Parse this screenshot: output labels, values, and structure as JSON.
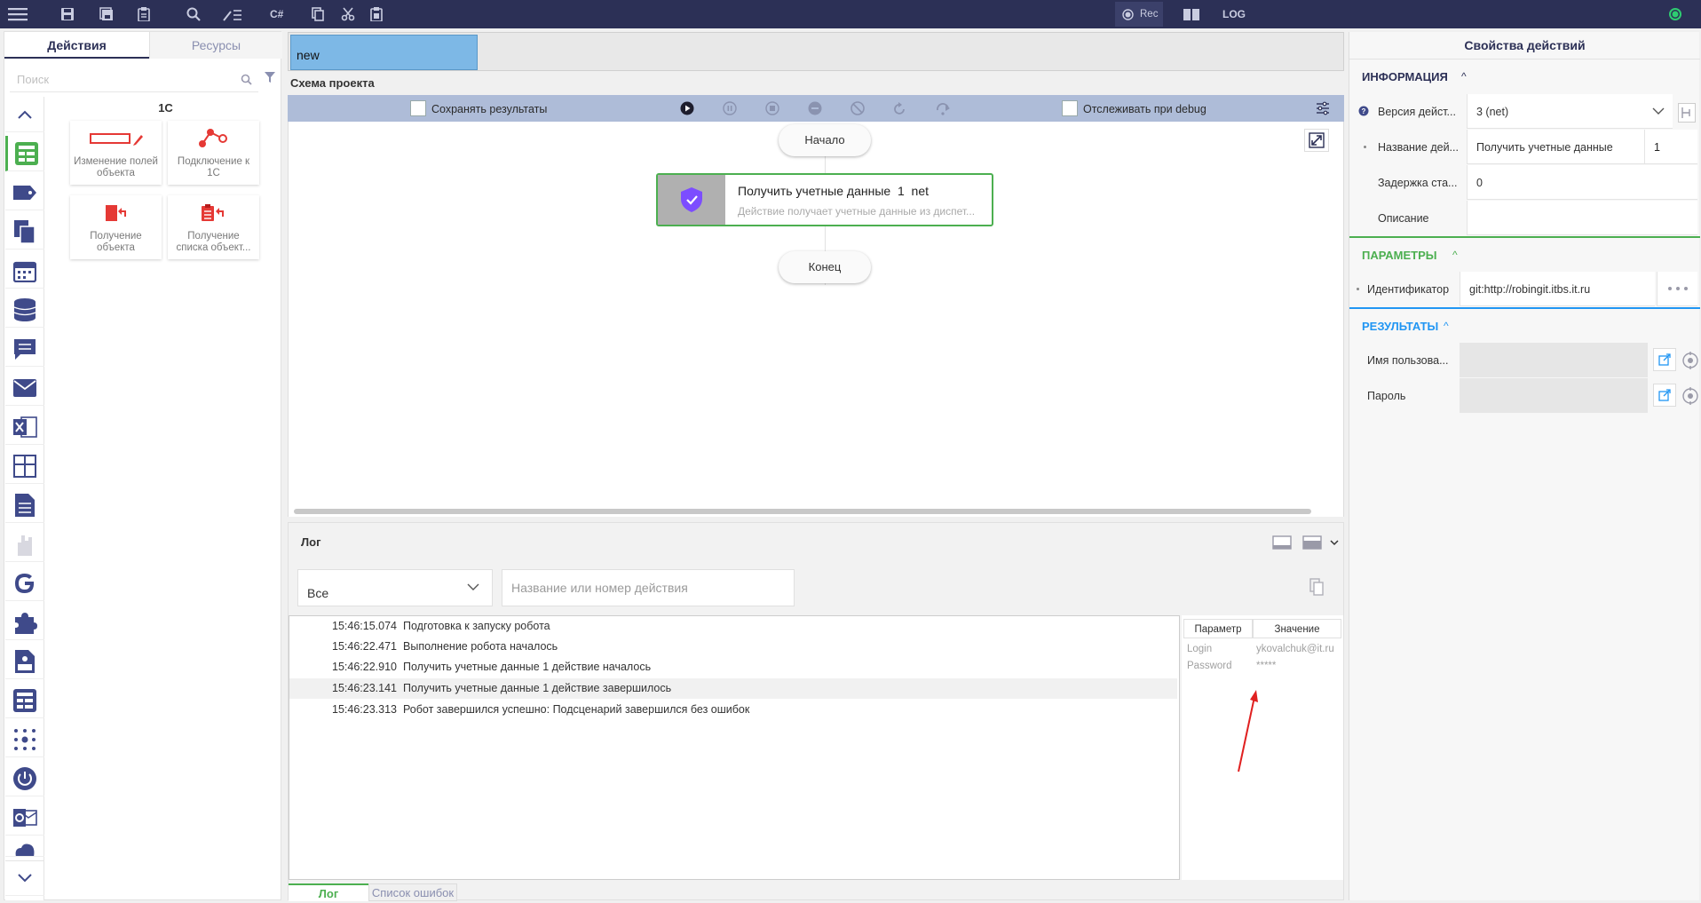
{
  "toolbar": {
    "icons": [
      "menu-icon",
      "save-icon",
      "save-all-icon",
      "clipboard-icon",
      "search-icon",
      "edit-list-icon",
      "csharp-icon",
      "copy-icon",
      "cut-icon",
      "paste-icon",
      "record-icon",
      "book-icon"
    ],
    "csharp_label": "C#",
    "rec_label": "Rec",
    "log_label": "LOG",
    "status_color": "#2ecc71"
  },
  "left": {
    "tab_actions": "Действия",
    "tab_resources": "Ресурсы",
    "search_placeholder": "Поиск",
    "category_title": "1С",
    "cards": [
      {
        "label": "Изменение полей объекта",
        "icon": "edit-fields-icon"
      },
      {
        "label": "Подключение к 1С",
        "icon": "connect-icon"
      },
      {
        "label": "Получение объекта",
        "icon": "get-object-icon"
      },
      {
        "label": "Получение списка объект...",
        "icon": "get-list-icon"
      }
    ],
    "side_icons": [
      "chevron-up-icon",
      "table-icon",
      "tag-icon",
      "copy-files-icon",
      "calendar-icon",
      "database-icon",
      "chat-icon",
      "mail-icon",
      "excel-icon",
      "grid-icon",
      "document-icon",
      "hand-icon",
      "google-icon",
      "puzzle-icon",
      "json-icon",
      "table2-icon",
      "dots-icon",
      "power-icon",
      "outlook-icon",
      "cloud-icon",
      "chevron-down-icon"
    ]
  },
  "editor": {
    "tab_name": "new",
    "schema_title": "Схема проекта",
    "save_results_label": "Сохранять результаты",
    "debug_track_label": "Отслеживать при debug",
    "start_label": "Начало",
    "end_label": "Конец",
    "node": {
      "title": "Получить учетные данные  1  net",
      "subtitle": "Действие получает учетные данные из диспет..."
    }
  },
  "log": {
    "title": "Лог",
    "filter_value": "Все",
    "filter_placeholder": "Название или номер действия",
    "entries": [
      {
        "time": "15:46:15.074",
        "message": "Подготовка к запуску робота"
      },
      {
        "time": "15:46:22.471",
        "message": "Выполнение робота началось"
      },
      {
        "time": "15:46:22.910",
        "message": "Получить учетные данные 1 действие началось"
      },
      {
        "time": "15:46:23.141",
        "message": "Получить учетные данные 1 действие завершилось"
      },
      {
        "time": "15:46:23.313",
        "message": "Робот завершился успешно: Подсценарий завершился без ошибок"
      }
    ],
    "param_header": "Параметр",
    "value_header": "Значение",
    "params": [
      {
        "name": "Login",
        "value": "ykovalchuk@it.ru"
      },
      {
        "name": "Password",
        "value": "*****"
      }
    ],
    "tab_log": "Лог",
    "tab_errors": "Список ошибок"
  },
  "props": {
    "title": "Свойства действий",
    "info_section": "ИНФОРМАЦИЯ",
    "info_rows": [
      {
        "label": "Версия дейст...",
        "value": "3 (net)"
      },
      {
        "label": "Название дей...",
        "value": "Получить учетные данные",
        "extra": "1"
      },
      {
        "label": "Задержка ста...",
        "value": "0"
      },
      {
        "label": "Описание",
        "value": ""
      }
    ],
    "params_section": "ПАРАМЕТРЫ",
    "param_rows": [
      {
        "label": "Идентификатор",
        "value": "git:http://robingit.itbs.it.ru"
      }
    ],
    "results_section": "РЕЗУЛЬТАТЫ",
    "result_rows": [
      {
        "label": "Имя пользова..."
      },
      {
        "label": "Пароль"
      }
    ],
    "info_color": "#2c3056",
    "params_color": "#4caf50",
    "results_color": "#2196f3"
  }
}
